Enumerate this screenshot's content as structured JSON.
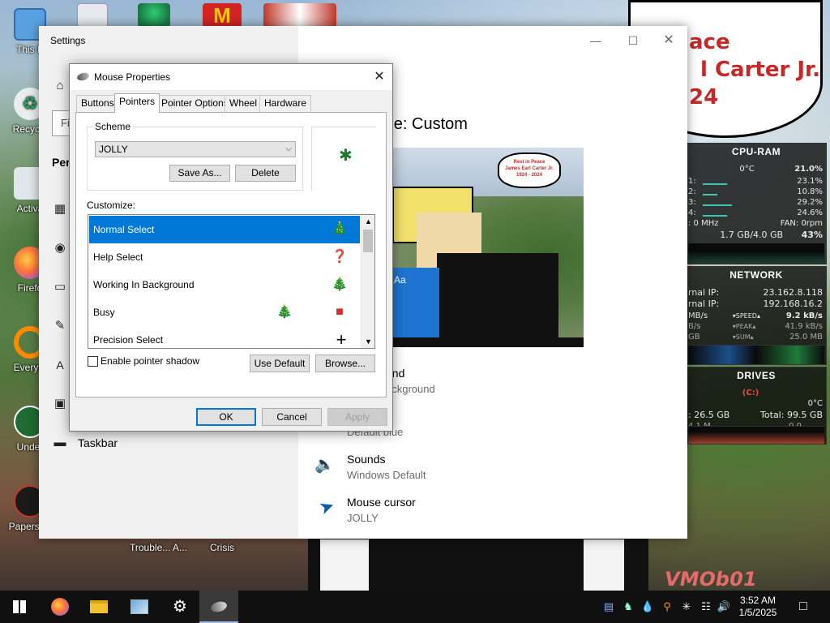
{
  "desktop": {
    "icons": [
      {
        "name": "this-pc-icon",
        "label": "This P"
      },
      {
        "name": "recycle-bin-icon",
        "label": "Recycle"
      },
      {
        "name": "activate-icon",
        "label": "Activa"
      },
      {
        "name": "firefox-icon",
        "label": "Firefo"
      },
      {
        "name": "everything-icon",
        "label": "Everyth"
      },
      {
        "name": "undertale-icon",
        "label": "Under"
      },
      {
        "name": "papers-please-icon",
        "label": "Papers, P"
      }
    ],
    "bottom_captions": [
      "Trouble... A...",
      "Crisis"
    ],
    "speech_bubble_lines": [
      "ace",
      "l Carter Jr.",
      "24"
    ],
    "wallpaper_sign": "VMOb01"
  },
  "gadgets": {
    "cpu": {
      "title": "CPU-RAM",
      "temp": "0°C",
      "total": "21.0%",
      "cores": [
        {
          "label": "1:",
          "value": "23.1%"
        },
        {
          "label": "2:",
          "value": "10.8%"
        },
        {
          "label": "3:",
          "value": "29.2%"
        },
        {
          "label": "4:",
          "value": "24.6%"
        }
      ],
      "freq": ": 0 MHz",
      "fan": "FAN: 0rpm",
      "ram": "1.7 GB/4.0 GB",
      "ram_pct": "43%"
    },
    "network": {
      "title": "NETWORK",
      "internal_ip_label": "rnal IP:",
      "internal_ip": "23.162.8.118",
      "local_ip_label": "rnal IP:",
      "local_ip": "192.168.16.2",
      "speed_label": "▾SPEED▴",
      "speed_unit": "MB/s",
      "speed": "9.2 kB/s",
      "peak_label": "▾PEAK▴",
      "peak_unit": "B/s",
      "peak": "41.9 kB/s",
      "sum_label": "▾SUM▴",
      "sum_unit": "GB",
      "sum": "25.0 MB"
    },
    "drives": {
      "title": "DRIVES",
      "drive": "(C:)",
      "temp": "0°C",
      "used": ": 26.5 GB",
      "total": "Total: 99.5 GB",
      "io_left": "4.1 M",
      "io_right": "0.0"
    }
  },
  "settings": {
    "window_title": "Settings",
    "search_fragment": "Fi",
    "section_fragment": "Per",
    "heading": "eme: Custom",
    "nav_items": [
      {
        "icon": "home-icon",
        "label": ""
      },
      {
        "icon": "picture-icon",
        "label": ""
      },
      {
        "icon": "palette-icon",
        "label": ""
      },
      {
        "icon": "lock-screen-icon",
        "label": ""
      },
      {
        "icon": "themes-icon",
        "label": ""
      },
      {
        "icon": "fonts-icon",
        "label": ""
      },
      {
        "icon": "start-icon",
        "label": ""
      },
      {
        "icon": "taskbar-icon",
        "label": "Taskbar"
      }
    ],
    "preview": {
      "bubble_line1": "Rest in Peace",
      "bubble_line2": "James Earl Carter Jr.",
      "bubble_line3": "1924 - 2024",
      "sample_text": "Aa"
    },
    "options": [
      {
        "title": "und",
        "subtitle": "ackground"
      },
      {
        "title": "",
        "subtitle": "Default blue"
      },
      {
        "title": "Sounds",
        "subtitle": "Windows Default"
      },
      {
        "title": "Mouse cursor",
        "subtitle": "JOLLY"
      }
    ]
  },
  "mouse_properties": {
    "title": "Mouse Properties",
    "tabs": [
      "Buttons",
      "Pointers",
      "Pointer Options",
      "Wheel",
      "Hardware"
    ],
    "active_tab": "Pointers",
    "scheme_label": "Scheme",
    "scheme_value": "JOLLY",
    "save_as": "Save As...",
    "delete": "Delete",
    "customize_label": "Customize:",
    "pointers": [
      {
        "label": "Normal Select",
        "selected": true
      },
      {
        "label": "Help Select",
        "selected": false
      },
      {
        "label": "Working In Background",
        "selected": false
      },
      {
        "label": "Busy",
        "selected": false
      },
      {
        "label": "Precision Select",
        "selected": false
      }
    ],
    "shadow_label": "Enable pointer shadow",
    "use_default": "Use Default",
    "browse": "Browse...",
    "ok": "OK",
    "cancel": "Cancel",
    "apply": "Apply"
  },
  "taskbar": {
    "apps": [
      "start-icon",
      "firefox-icon",
      "file-explorer-icon",
      "control-panel-icon",
      "settings-gear-icon",
      "mouse-icon"
    ],
    "time": "3:52 AM",
    "date": "1/5/2025"
  },
  "colors": {
    "accent": "#0078d7",
    "gadget_bg": "#0f0f0f",
    "speech_text": "#c62828"
  }
}
